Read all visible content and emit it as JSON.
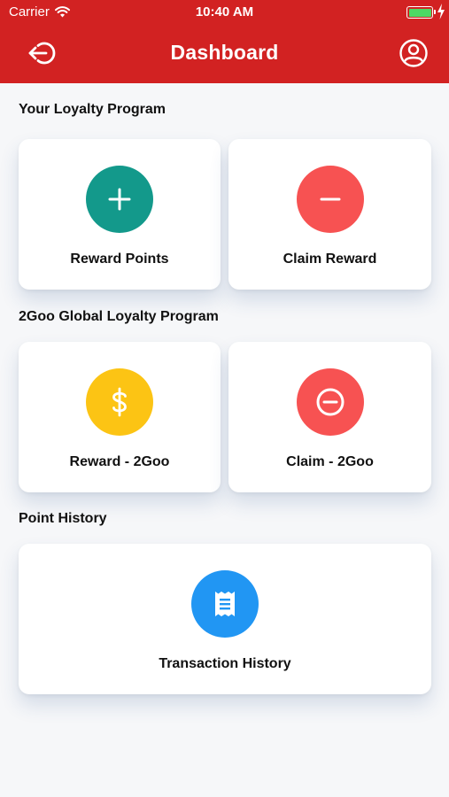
{
  "status_bar": {
    "carrier": "Carrier",
    "time": "10:40 AM",
    "battery_level": 1.0
  },
  "header": {
    "title": "Dashboard",
    "left_icon": "logout-icon",
    "right_icon": "user-profile-icon",
    "background_color": "#d22222"
  },
  "sections": {
    "loyalty": {
      "title": "Your Loyalty Program",
      "reward_points": {
        "label": "Reward Points",
        "icon": "plus-icon",
        "color": "#13998b"
      },
      "claim_reward": {
        "label": "Claim Reward",
        "icon": "minus-icon",
        "color": "#f75252"
      }
    },
    "global": {
      "title": "2Goo Global Loyalty Program",
      "reward_2goo": {
        "label": "Reward - 2Goo",
        "icon": "dollar-icon",
        "color": "#fcc414"
      },
      "claim_2goo": {
        "label": "Claim - 2Goo",
        "icon": "minus-circle-icon",
        "color": "#f75252"
      }
    },
    "history": {
      "title": "Point History",
      "transaction_history": {
        "label": "Transaction History",
        "icon": "receipt-icon",
        "color": "#2196f3"
      }
    }
  }
}
